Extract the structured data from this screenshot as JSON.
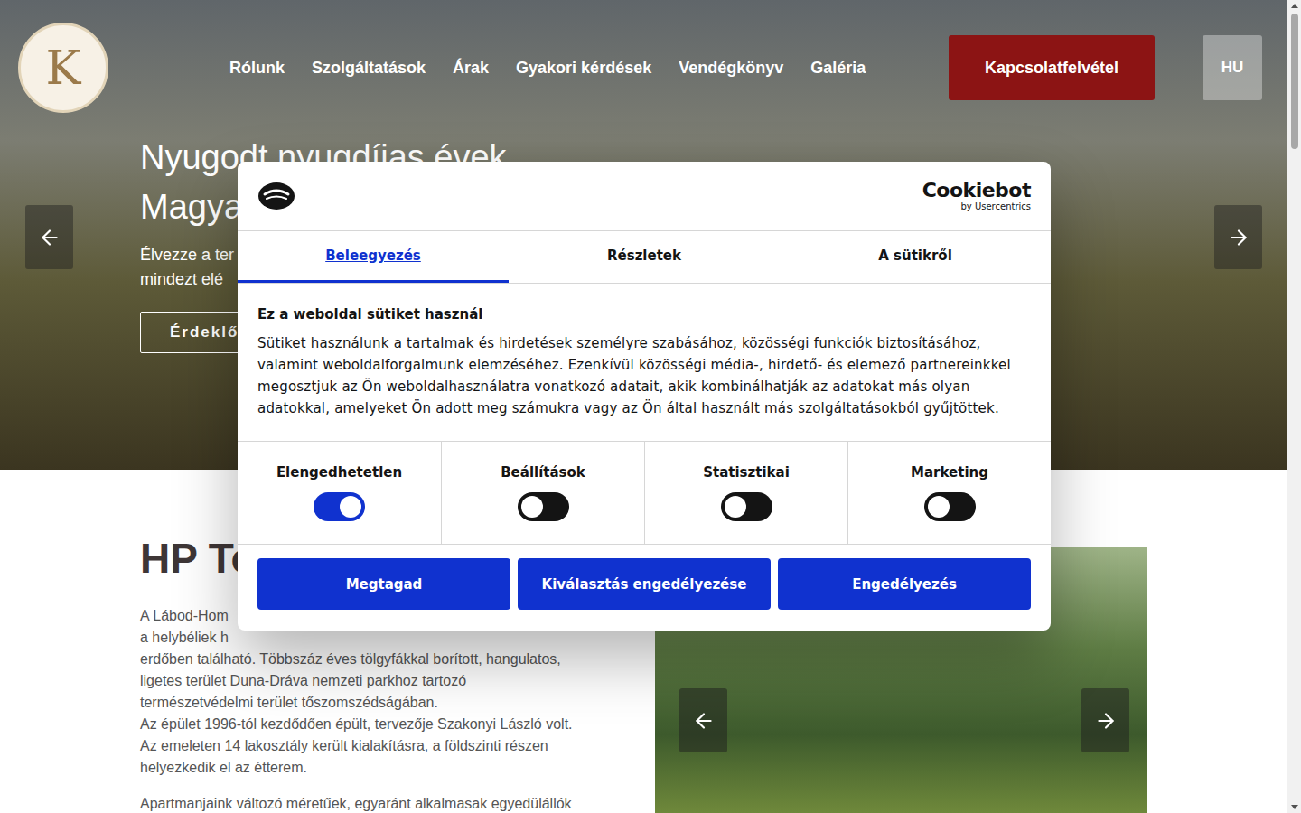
{
  "header": {
    "logo": {
      "letter": "K"
    },
    "nav": [
      "Rólunk",
      "Szolgáltatások",
      "Árak",
      "Gyakori kérdések",
      "Vendégkönyv",
      "Galéria"
    ],
    "contact_button": "Kapcsolatfelvétel",
    "language_button": "HU"
  },
  "hero": {
    "title_lines": [
      "Nyugodt nyugdíjas évek",
      "Magya"
    ],
    "text_lines": [
      "Élvezze a ter",
      "mindezt elé"
    ],
    "cta": "Érdeklő"
  },
  "intro": {
    "heading": "HP To",
    "paragraph_lines": [
      "A Lábod-Hom",
      "a helybéliek h",
      "erdőben található. Többszáz éves tölgyfákkal borított, hangulatos,",
      "ligetes terület Duna-Dráva nemzeti parkhoz tartozó",
      "természetvédelmi terület tőszomszédságában.",
      "Az épület 1996-tól kezdődően épült, tervezője Szakonyi László volt.",
      "Az emeleten 14 lakosztály került kialakításra, a földszinti részen",
      "helyezkedik el az étterem."
    ],
    "second_paragraph_lines": [
      "Apartmanjaink változó méretűek, egyaránt alkalmasak egyedülállók"
    ]
  },
  "cookie_dialog": {
    "brand": {
      "name": "Cookiebot",
      "by": "by Usercentrics"
    },
    "tabs": [
      {
        "label": "Beleegyezés",
        "selected": true
      },
      {
        "label": "Részletek",
        "selected": false
      },
      {
        "label": "A sütikről",
        "selected": false
      }
    ],
    "title": "Ez a weboldal sütiket használ",
    "body": "Sütiket használunk a tartalmak és hirdetések személyre szabásához, közösségi funkciók biztosításához, valamint weboldalforgalmunk elemzéséhez. Ezenkívül közösségi média-, hirdető- és elemező partnereinkkel megosztjuk az Ön weboldalhasználatra vonatkozó adatait, akik kombinálhatják az adatokat más olyan adatokkal, amelyeket Ön adott meg számukra vagy az Ön által használt más szolgáltatásokból gyűjtöttek.",
    "toggles": [
      {
        "label": "Elengedhetetlen",
        "on": true
      },
      {
        "label": "Beállítások",
        "on": false
      },
      {
        "label": "Statisztikai",
        "on": false
      },
      {
        "label": "Marketing",
        "on": false
      }
    ],
    "buttons": [
      "Megtagad",
      "Kiválasztás engedélyezése",
      "Engedélyezés"
    ]
  }
}
